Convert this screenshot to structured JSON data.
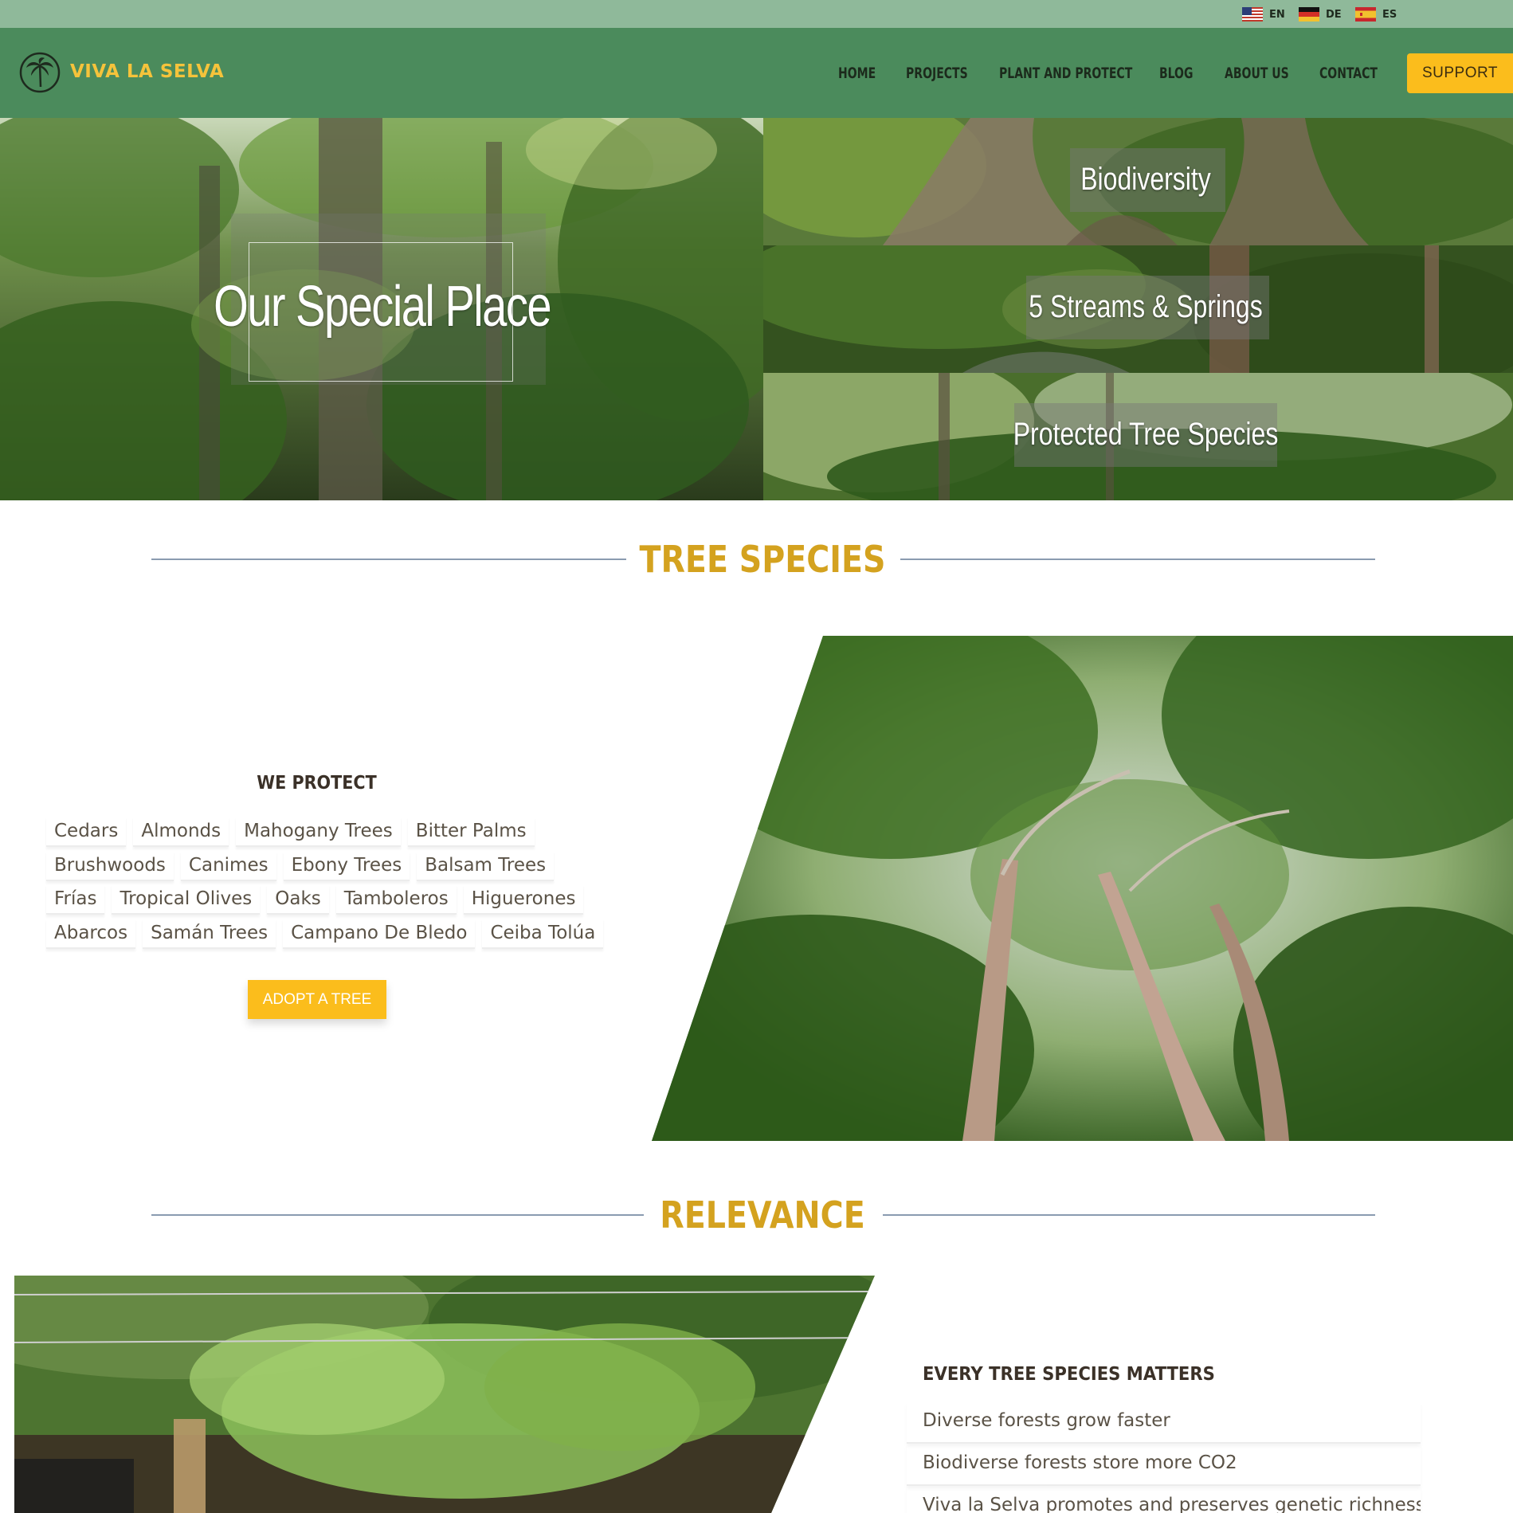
{
  "languages": [
    {
      "code": "EN",
      "flag": "us-flag-icon"
    },
    {
      "code": "DE",
      "flag": "de-flag-icon"
    },
    {
      "code": "ES",
      "flag": "es-flag-icon"
    }
  ],
  "brand": {
    "name": "VIVA LA SELVA",
    "logo_icon": "palm-tree-icon",
    "name_color": "#f5c33b"
  },
  "nav": {
    "items": [
      "HOME",
      "PROJECTS",
      "PLANT AND PROTECT",
      "BLOG",
      "ABOUT US",
      "CONTACT"
    ],
    "support_label": "SUPPORT"
  },
  "hero": {
    "main_title": "Our Special Place",
    "panels": [
      "Biodiversity",
      "5 Streams & Springs",
      "Protected Tree Species"
    ]
  },
  "tree_species": {
    "heading": "TREE SPECIES",
    "subheading": "WE PROTECT",
    "species_rows": [
      [
        "Cedars",
        "Almonds",
        "Mahogany Trees",
        "Bitter Palms"
      ],
      [
        "Brushwoods",
        "Canimes",
        "Ebony Trees",
        "Balsam Trees"
      ],
      [
        "Frías",
        "Tropical Olives",
        "Oaks",
        "Tamboleros",
        "Higuerones"
      ],
      [
        "Abarcos",
        "Samán Trees",
        "Campano De Bledo",
        "Ceiba Tolúa"
      ]
    ],
    "adopt_label": "ADOPT A TREE"
  },
  "relevance": {
    "heading": "RELEVANCE",
    "subheading": "EVERY TREE SPECIES MATTERS",
    "points": [
      "Diverse forests grow faster",
      "Biodiverse forests store more CO2",
      "Viva la Selva promotes and preserves genetic richness"
    ]
  },
  "colors": {
    "lang_bar": "#8fb99a",
    "header": "#4b8b5c",
    "accent": "#fbbd1c",
    "heading": "#d4a21f",
    "rule": "#8a9bb0"
  }
}
